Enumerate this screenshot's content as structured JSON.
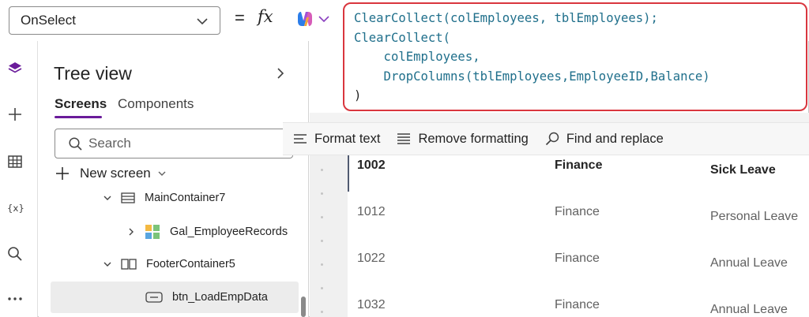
{
  "formula_bar": {
    "property": "OnSelect",
    "equals": "=",
    "fx": "fx",
    "code_lines": [
      "ClearCollect(colEmployees, tblEmployees);",
      "ClearCollect(",
      "    colEmployees,",
      "    DropColumns(tblEmployees,EmployeeID,Balance)",
      ")"
    ]
  },
  "tree_view": {
    "title": "Tree view",
    "tabs": [
      "Screens",
      "Components"
    ],
    "search_placeholder": "Search",
    "new_screen": "New screen",
    "items": [
      {
        "label": "MainContainer7"
      },
      {
        "label": "Gal_EmployeeRecords"
      },
      {
        "label": "FooterContainer5"
      },
      {
        "label": "btn_LoadEmpData"
      }
    ]
  },
  "toolbar": {
    "format_text": "Format text",
    "remove_formatting": "Remove formatting",
    "find_replace": "Find and replace"
  },
  "gallery_rows": [
    {
      "id": "1002",
      "department": "Finance",
      "leave": "Sick Leave"
    },
    {
      "id": "1012",
      "department": "Finance",
      "leave": "Personal Leave"
    },
    {
      "id": "1022",
      "department": "Finance",
      "leave": "Annual Leave"
    },
    {
      "id": "1032",
      "department": "Finance",
      "leave": "Annual Leave"
    }
  ],
  "colors": {
    "accent": "#6a1b9a",
    "highlight_border": "#d9363e",
    "code": "#0d7a8e"
  }
}
